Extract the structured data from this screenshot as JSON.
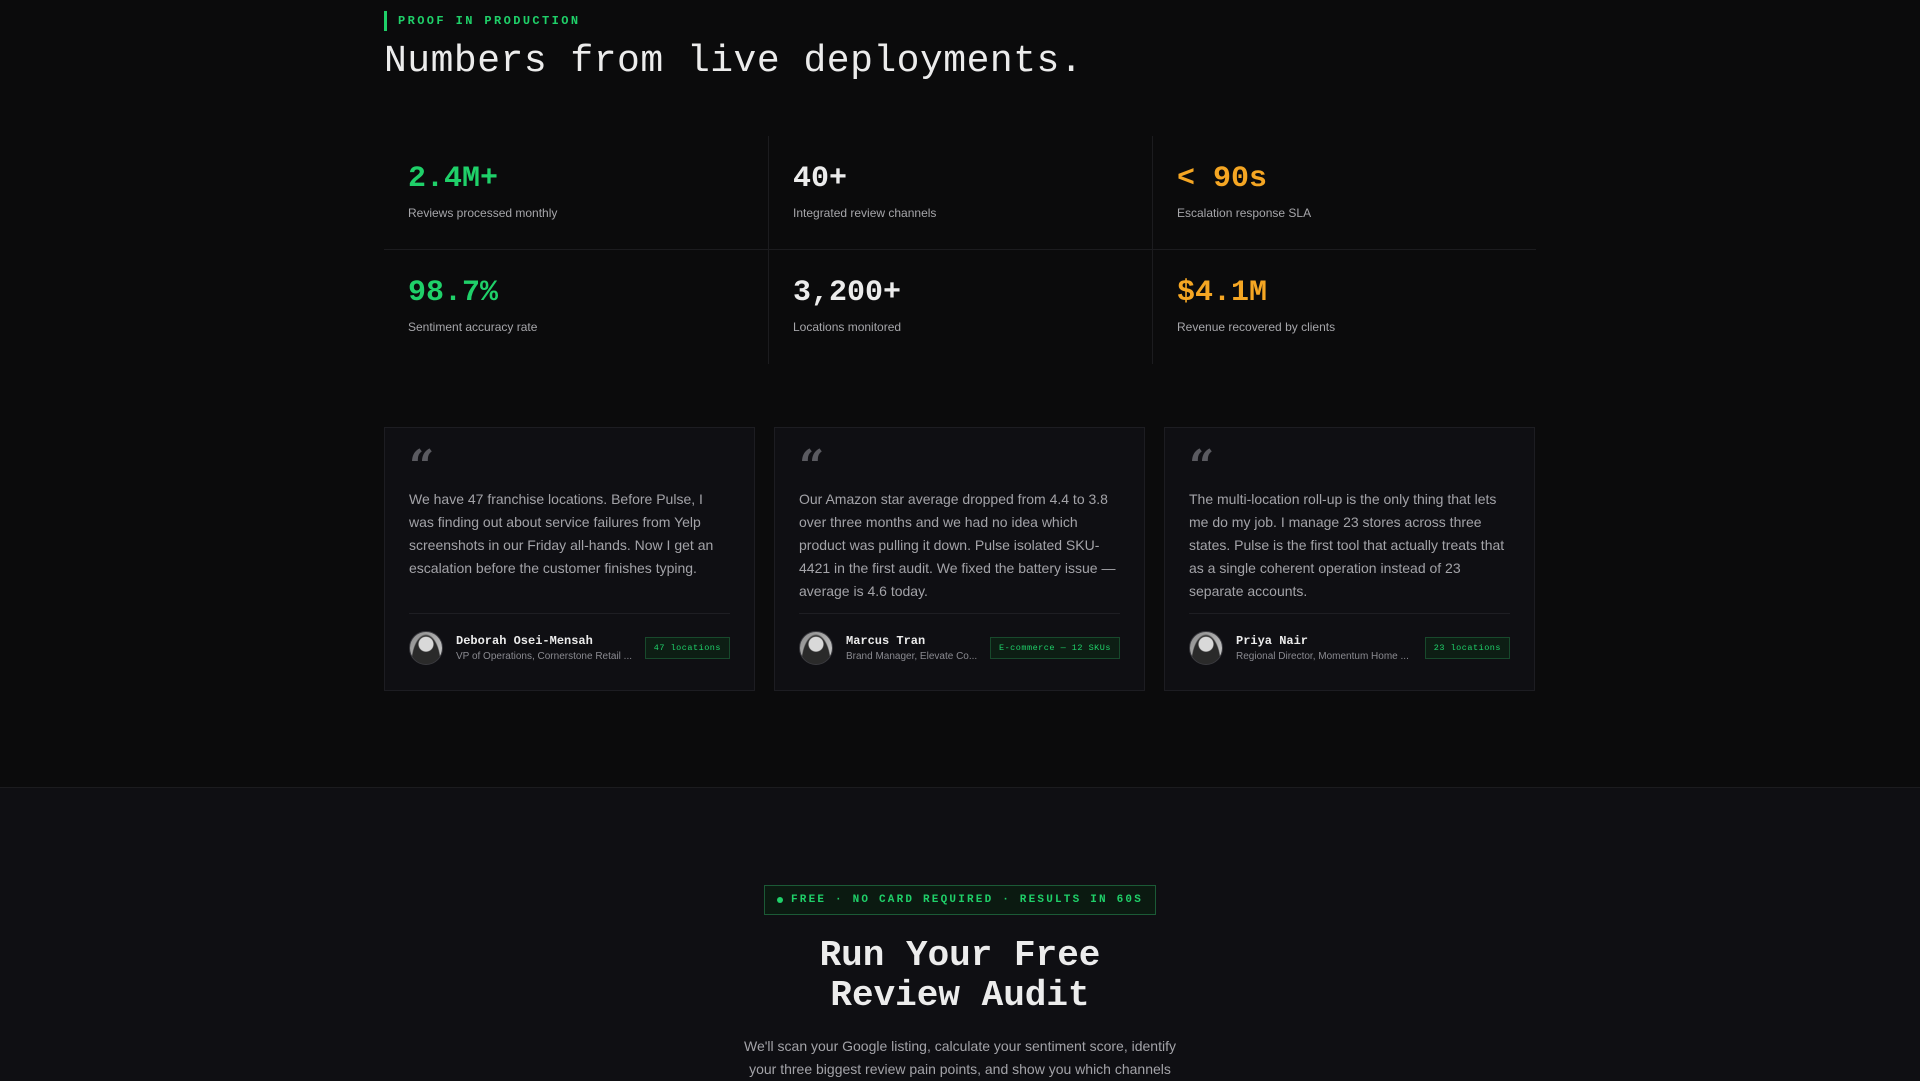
{
  "proof": {
    "eyebrow": "PROOF IN PRODUCTION",
    "headline": "Numbers from live deployments."
  },
  "stats": [
    {
      "value": "2.4M+",
      "label": "Reviews processed monthly",
      "color": "#1fd069"
    },
    {
      "value": "40+",
      "label": "Integrated review channels",
      "color": "#ececec"
    },
    {
      "value": "< 90s",
      "label": "Escalation response SLA",
      "color": "#f5a623"
    },
    {
      "value": "98.7%",
      "label": "Sentiment accuracy rate",
      "color": "#1fd069"
    },
    {
      "value": "3,200+",
      "label": "Locations monitored",
      "color": "#ececec"
    },
    {
      "value": "$4.1M",
      "label": "Revenue recovered by clients",
      "color": "#f5a623"
    }
  ],
  "testimonials": [
    {
      "quote_icon": "quote-icon",
      "text": "We have 47 franchise locations. Before Pulse, I was finding out about service failures from Yelp screenshots in our Friday all-hands. Now I get an escalation before the customer finishes typing.",
      "name": "Deborah Osei-Mensah",
      "role": "VP of Operations, Cornerstone Retail ...",
      "tag": "47 locations"
    },
    {
      "quote_icon": "quote-icon",
      "text": "Our Amazon star average dropped from 4.4 to 3.8 over three months and we had no idea which product was pulling it down. Pulse isolated SKU-4421 in the first audit. We fixed the battery issue — average is 4.6 today.",
      "name": "Marcus Tran",
      "role": "Brand Manager, Elevate Co...",
      "tag": "E-commerce — 12 SKUs"
    },
    {
      "quote_icon": "quote-icon",
      "text": "The multi-location roll-up is the only thing that lets me do my job. I manage 23 stores across three states. Pulse is the first tool that actually treats that as a single coherent operation instead of 23 separate accounts.",
      "name": "Priya Nair",
      "role": "Regional Director, Momentum Home ...",
      "tag": "23 locations"
    }
  ],
  "cta": {
    "pill": "FREE · NO CARD REQUIRED · RESULTS IN 60S",
    "title_line1": "Run Your Free",
    "title_line2": "Review Audit",
    "subtitle": "We'll scan your Google listing, calculate your sentiment score, identify your three biggest review pain points, and show you which channels"
  },
  "colors": {
    "accent_green": "#1fd069",
    "accent_amber": "#f5a623",
    "background": "#0b0b0c"
  }
}
